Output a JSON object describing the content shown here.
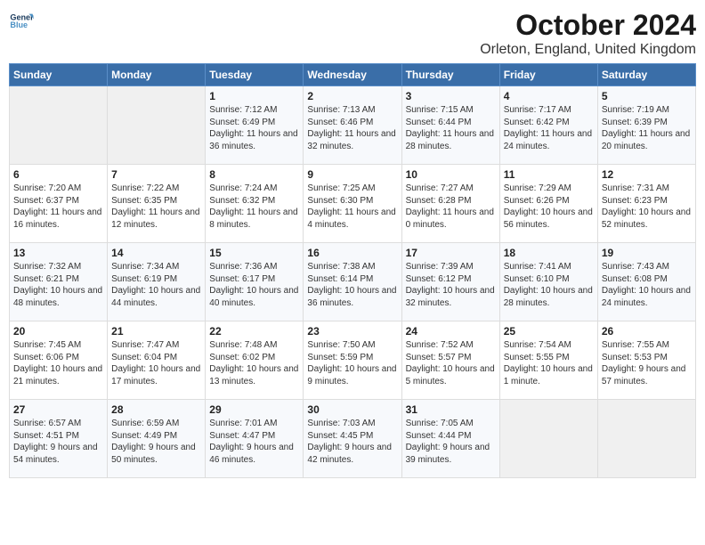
{
  "logo": {
    "line1": "General",
    "line2": "Blue"
  },
  "title": "October 2024",
  "subtitle": "Orleton, England, United Kingdom",
  "days_of_week": [
    "Sunday",
    "Monday",
    "Tuesday",
    "Wednesday",
    "Thursday",
    "Friday",
    "Saturday"
  ],
  "weeks": [
    [
      {
        "day": "",
        "empty": true
      },
      {
        "day": "",
        "empty": true
      },
      {
        "day": "1",
        "sunrise": "Sunrise: 7:12 AM",
        "sunset": "Sunset: 6:49 PM",
        "daylight": "Daylight: 11 hours and 36 minutes."
      },
      {
        "day": "2",
        "sunrise": "Sunrise: 7:13 AM",
        "sunset": "Sunset: 6:46 PM",
        "daylight": "Daylight: 11 hours and 32 minutes."
      },
      {
        "day": "3",
        "sunrise": "Sunrise: 7:15 AM",
        "sunset": "Sunset: 6:44 PM",
        "daylight": "Daylight: 11 hours and 28 minutes."
      },
      {
        "day": "4",
        "sunrise": "Sunrise: 7:17 AM",
        "sunset": "Sunset: 6:42 PM",
        "daylight": "Daylight: 11 hours and 24 minutes."
      },
      {
        "day": "5",
        "sunrise": "Sunrise: 7:19 AM",
        "sunset": "Sunset: 6:39 PM",
        "daylight": "Daylight: 11 hours and 20 minutes."
      }
    ],
    [
      {
        "day": "6",
        "sunrise": "Sunrise: 7:20 AM",
        "sunset": "Sunset: 6:37 PM",
        "daylight": "Daylight: 11 hours and 16 minutes."
      },
      {
        "day": "7",
        "sunrise": "Sunrise: 7:22 AM",
        "sunset": "Sunset: 6:35 PM",
        "daylight": "Daylight: 11 hours and 12 minutes."
      },
      {
        "day": "8",
        "sunrise": "Sunrise: 7:24 AM",
        "sunset": "Sunset: 6:32 PM",
        "daylight": "Daylight: 11 hours and 8 minutes."
      },
      {
        "day": "9",
        "sunrise": "Sunrise: 7:25 AM",
        "sunset": "Sunset: 6:30 PM",
        "daylight": "Daylight: 11 hours and 4 minutes."
      },
      {
        "day": "10",
        "sunrise": "Sunrise: 7:27 AM",
        "sunset": "Sunset: 6:28 PM",
        "daylight": "Daylight: 11 hours and 0 minutes."
      },
      {
        "day": "11",
        "sunrise": "Sunrise: 7:29 AM",
        "sunset": "Sunset: 6:26 PM",
        "daylight": "Daylight: 10 hours and 56 minutes."
      },
      {
        "day": "12",
        "sunrise": "Sunrise: 7:31 AM",
        "sunset": "Sunset: 6:23 PM",
        "daylight": "Daylight: 10 hours and 52 minutes."
      }
    ],
    [
      {
        "day": "13",
        "sunrise": "Sunrise: 7:32 AM",
        "sunset": "Sunset: 6:21 PM",
        "daylight": "Daylight: 10 hours and 48 minutes."
      },
      {
        "day": "14",
        "sunrise": "Sunrise: 7:34 AM",
        "sunset": "Sunset: 6:19 PM",
        "daylight": "Daylight: 10 hours and 44 minutes."
      },
      {
        "day": "15",
        "sunrise": "Sunrise: 7:36 AM",
        "sunset": "Sunset: 6:17 PM",
        "daylight": "Daylight: 10 hours and 40 minutes."
      },
      {
        "day": "16",
        "sunrise": "Sunrise: 7:38 AM",
        "sunset": "Sunset: 6:14 PM",
        "daylight": "Daylight: 10 hours and 36 minutes."
      },
      {
        "day": "17",
        "sunrise": "Sunrise: 7:39 AM",
        "sunset": "Sunset: 6:12 PM",
        "daylight": "Daylight: 10 hours and 32 minutes."
      },
      {
        "day": "18",
        "sunrise": "Sunrise: 7:41 AM",
        "sunset": "Sunset: 6:10 PM",
        "daylight": "Daylight: 10 hours and 28 minutes."
      },
      {
        "day": "19",
        "sunrise": "Sunrise: 7:43 AM",
        "sunset": "Sunset: 6:08 PM",
        "daylight": "Daylight: 10 hours and 24 minutes."
      }
    ],
    [
      {
        "day": "20",
        "sunrise": "Sunrise: 7:45 AM",
        "sunset": "Sunset: 6:06 PM",
        "daylight": "Daylight: 10 hours and 21 minutes."
      },
      {
        "day": "21",
        "sunrise": "Sunrise: 7:47 AM",
        "sunset": "Sunset: 6:04 PM",
        "daylight": "Daylight: 10 hours and 17 minutes."
      },
      {
        "day": "22",
        "sunrise": "Sunrise: 7:48 AM",
        "sunset": "Sunset: 6:02 PM",
        "daylight": "Daylight: 10 hours and 13 minutes."
      },
      {
        "day": "23",
        "sunrise": "Sunrise: 7:50 AM",
        "sunset": "Sunset: 5:59 PM",
        "daylight": "Daylight: 10 hours and 9 minutes."
      },
      {
        "day": "24",
        "sunrise": "Sunrise: 7:52 AM",
        "sunset": "Sunset: 5:57 PM",
        "daylight": "Daylight: 10 hours and 5 minutes."
      },
      {
        "day": "25",
        "sunrise": "Sunrise: 7:54 AM",
        "sunset": "Sunset: 5:55 PM",
        "daylight": "Daylight: 10 hours and 1 minute."
      },
      {
        "day": "26",
        "sunrise": "Sunrise: 7:55 AM",
        "sunset": "Sunset: 5:53 PM",
        "daylight": "Daylight: 9 hours and 57 minutes."
      }
    ],
    [
      {
        "day": "27",
        "sunrise": "Sunrise: 6:57 AM",
        "sunset": "Sunset: 4:51 PM",
        "daylight": "Daylight: 9 hours and 54 minutes."
      },
      {
        "day": "28",
        "sunrise": "Sunrise: 6:59 AM",
        "sunset": "Sunset: 4:49 PM",
        "daylight": "Daylight: 9 hours and 50 minutes."
      },
      {
        "day": "29",
        "sunrise": "Sunrise: 7:01 AM",
        "sunset": "Sunset: 4:47 PM",
        "daylight": "Daylight: 9 hours and 46 minutes."
      },
      {
        "day": "30",
        "sunrise": "Sunrise: 7:03 AM",
        "sunset": "Sunset: 4:45 PM",
        "daylight": "Daylight: 9 hours and 42 minutes."
      },
      {
        "day": "31",
        "sunrise": "Sunrise: 7:05 AM",
        "sunset": "Sunset: 4:44 PM",
        "daylight": "Daylight: 9 hours and 39 minutes."
      },
      {
        "day": "",
        "empty": true
      },
      {
        "day": "",
        "empty": true
      }
    ]
  ]
}
